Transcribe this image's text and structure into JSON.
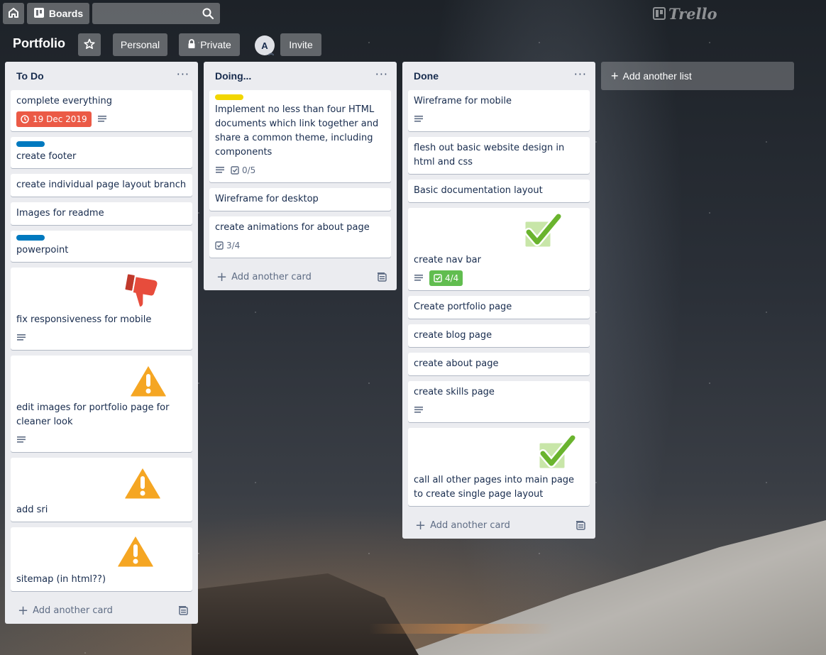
{
  "header": {
    "boards_label": "Boards",
    "logo_text": "Trello"
  },
  "board": {
    "title": "Portfolio",
    "personal_label": "Personal",
    "private_label": "Private",
    "avatar_initial": "A",
    "invite_label": "Invite"
  },
  "lists": [
    {
      "title": "To Do",
      "add_card_label": "Add another card",
      "cards": [
        {
          "title": "complete everything",
          "due": "19 Dec 2019",
          "has_description": true
        },
        {
          "title": "create footer",
          "label_color": "#0079bf"
        },
        {
          "title": "create individual page layout branch"
        },
        {
          "title": "Images for readme"
        },
        {
          "title": "powerpoint",
          "label_color": "#0079bf"
        },
        {
          "title": "fix responsiveness for mobile",
          "sticker": "thumbs-down",
          "has_description": true
        },
        {
          "title": "edit images for portfolio page for cleaner look",
          "sticker": "warning",
          "has_description": true
        },
        {
          "title": "add sri",
          "sticker": "warning"
        },
        {
          "title": "sitemap (in html??)",
          "sticker": "warning"
        }
      ]
    },
    {
      "title": "Doing...",
      "add_card_label": "Add another card",
      "cards": [
        {
          "title": "Implement no less than four HTML documents which link together and share a common theme, including components",
          "label_color": "#f2d600",
          "has_description": true,
          "checklist": "0/5"
        },
        {
          "title": "Wireframe for desktop"
        },
        {
          "title": "create animations for about page",
          "checklist": "3/4"
        }
      ]
    },
    {
      "title": "Done",
      "add_card_label": "Add another card",
      "cards": [
        {
          "title": "Wireframe for mobile",
          "has_description": true
        },
        {
          "title": "flesh out basic website design in html and css"
        },
        {
          "title": "Basic documentation layout"
        },
        {
          "title": "create nav bar",
          "sticker": "check",
          "has_description": true,
          "checklist": "4/4",
          "checklist_complete": true
        },
        {
          "title": "Create portfolio page"
        },
        {
          "title": "create blog page"
        },
        {
          "title": "create about page"
        },
        {
          "title": "create skills page",
          "has_description": true
        },
        {
          "title": "call all other pages into main page to create single page layout",
          "sticker": "check"
        }
      ]
    }
  ],
  "add_list_label": "Add another list",
  "colors": {
    "list_bg": "#ebecf0",
    "due_badge": "#eb5a46",
    "checklist_complete": "#61bd4f",
    "label_blue": "#0079bf",
    "label_yellow": "#f2d600"
  }
}
